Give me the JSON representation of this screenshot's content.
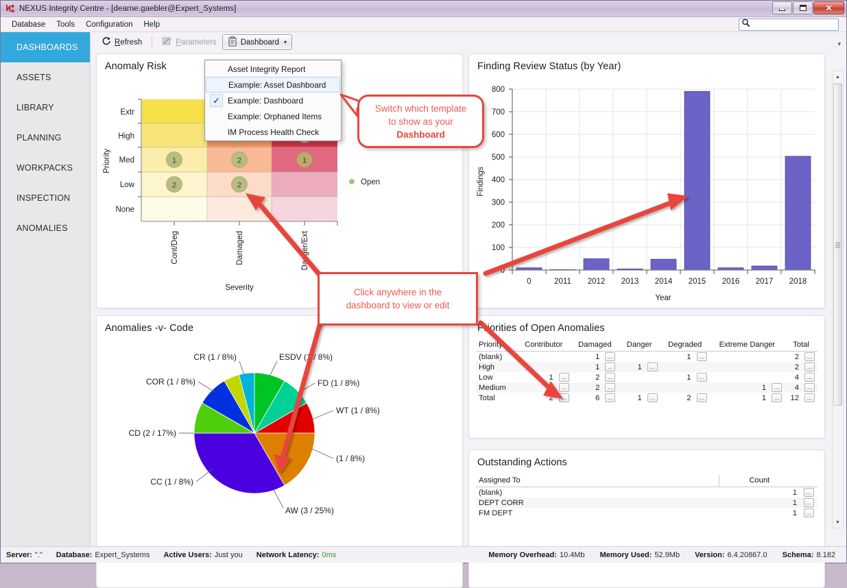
{
  "window": {
    "title": "NEXUS Integrity Centre - [dearne.gaebler@Expert_Systems]",
    "app_icon": "nexus-logo-icon",
    "minimize_label": "Minimize",
    "maximize_label": "Maximize",
    "close_label": "Close",
    "close_glyph": "✕"
  },
  "menubar": {
    "items": [
      "Database",
      "Tools",
      "Configuration",
      "Help"
    ],
    "search": {
      "value": "",
      "placeholder": "",
      "icon": "search-icon"
    }
  },
  "sidebar": {
    "items": [
      {
        "label": "DASHBOARDS",
        "active": true
      },
      {
        "label": "ASSETS",
        "active": false
      },
      {
        "label": "LIBRARY",
        "active": false
      },
      {
        "label": "PLANNING",
        "active": false
      },
      {
        "label": "WORKPACKS",
        "active": false
      },
      {
        "label": "INSPECTION",
        "active": false
      },
      {
        "label": "ANOMALIES",
        "active": false
      }
    ],
    "active_color": "#33a8dc"
  },
  "toolbar": {
    "refresh_label": "Refresh",
    "refresh_icon": "refresh-icon",
    "parameters_label": "Parameters",
    "parameters_icon": "parameters-icon",
    "parameters_disabled": true,
    "dashboard_label": "Dashboard",
    "dashboard_icon": "clipboard-icon",
    "dashboard_caret": "▾",
    "collapse_arrow": "▾"
  },
  "dropdown": {
    "items": [
      {
        "label": "Asset Integrity Report",
        "checked": false,
        "highlighted": false
      },
      {
        "label": "Example: Asset Dashboard",
        "checked": false,
        "highlighted": true
      },
      {
        "label": "Example: Dashboard",
        "checked": true,
        "highlighted": false
      },
      {
        "label": "Example: Orphaned Items",
        "checked": false,
        "highlighted": false
      },
      {
        "label": "IM Process Health Check",
        "checked": false,
        "highlighted": false
      }
    ],
    "check_glyph": "✓"
  },
  "callouts": [
    {
      "id": "template-callout",
      "lines": [
        "Switch which template",
        "to show as your"
      ],
      "bold_line": "Dashboard"
    },
    {
      "id": "click-callout",
      "lines": [
        "Click anywhere in the",
        "dashboard to view or edit"
      ],
      "bold_line": ""
    }
  ],
  "panels": {
    "anomaly_risk": {
      "title": "Anomaly Risk"
    },
    "finding_review": {
      "title": "Finding Review Status (by Year)"
    },
    "anomalies_code": {
      "title": "Anomalies -v- Code"
    },
    "priorities": {
      "title": "Priorities of Open Anomalies"
    },
    "outstanding": {
      "title": "Outstanding Actions"
    }
  },
  "chart_data": [
    {
      "id": "anomaly-risk-heatmap",
      "type": "heatmap",
      "title": "Anomaly Risk",
      "xlabel": "Severity",
      "ylabel": "Priority",
      "header_label": "Anomaly Risk",
      "xticks": [
        "Cont/Deg",
        "Damaged",
        "Danger/Ext"
      ],
      "yticks": [
        "Extr",
        "High",
        "Med",
        "Low",
        "None"
      ],
      "legend": [
        {
          "label": "Open",
          "color": "#b5b87a"
        }
      ],
      "legend_position": "right",
      "cells": [
        {
          "y": "Extr",
          "x": "Cont/Deg",
          "value": null,
          "color": "#f7e04a"
        },
        {
          "y": "Extr",
          "x": "Damaged",
          "value": null,
          "color": "#f4934f"
        },
        {
          "y": "Extr",
          "x": "Danger/Ext",
          "value": null,
          "color": "#d32f45"
        },
        {
          "y": "High",
          "x": "Cont/Deg",
          "value": null,
          "color": "#f8e479"
        },
        {
          "y": "High",
          "x": "Damaged",
          "value": 1,
          "color": "#f79b63"
        },
        {
          "y": "High",
          "x": "Danger/Ext",
          "value": 1,
          "color": "#d6334a"
        },
        {
          "y": "Med",
          "x": "Cont/Deg",
          "value": 1,
          "color": "#fbedab"
        },
        {
          "y": "Med",
          "x": "Damaged",
          "value": 2,
          "color": "#fab995"
        },
        {
          "y": "Med",
          "x": "Danger/Ext",
          "value": 1,
          "color": "#e0687f"
        },
        {
          "y": "Low",
          "x": "Cont/Deg",
          "value": 2,
          "color": "#fdf5cd"
        },
        {
          "y": "Low",
          "x": "Damaged",
          "value": 2,
          "color": "#fcdcc8"
        },
        {
          "y": "Low",
          "x": "Danger/Ext",
          "value": null,
          "color": "#ecacbd"
        },
        {
          "y": "None",
          "x": "Cont/Deg",
          "value": null,
          "color": "#fefbe7"
        },
        {
          "y": "None",
          "x": "Damaged",
          "value": null,
          "color": "#fdeade"
        },
        {
          "y": "None",
          "x": "Danger/Ext",
          "value": null,
          "color": "#f5d5de"
        }
      ]
    },
    {
      "id": "finding-review-status",
      "type": "bar",
      "title": "Finding Review Status (by Year)",
      "xlabel": "Year",
      "ylabel": "Findings",
      "categories": [
        "0",
        "2011",
        "2012",
        "2013",
        "2014",
        "2015",
        "2016",
        "2017",
        "2018"
      ],
      "values": [
        10,
        2,
        50,
        5,
        48,
        790,
        10,
        18,
        503
      ],
      "yticks": [
        0,
        100,
        200,
        300,
        400,
        500,
        600,
        700,
        800
      ],
      "ylim": [
        0,
        800
      ],
      "bar_color": "#6b63c6",
      "grid": true,
      "legend_position": "none"
    },
    {
      "id": "anomalies-v-code",
      "type": "pie",
      "title": "Anomalies -v- Code",
      "labels": [
        "ESDV (1 / 8%)",
        "FD (1 / 8%)",
        "WT (1 / 8%)",
        "(1 / 8%)",
        "AW (3 / 25%)",
        "CC (1 / 8%)",
        "CD (2 / 17%)",
        "COR (1 / 8%)",
        "CR (1 / 8%)"
      ],
      "values": [
        1,
        1,
        1,
        1,
        3,
        1,
        2,
        1,
        1
      ],
      "percents": [
        8,
        8,
        8,
        8,
        25,
        8,
        17,
        8,
        8
      ],
      "colors": [
        "#00c424",
        "#00d194",
        "#e00000",
        "#dd8000",
        "#4b00e0",
        "#4fcf0c",
        "#0030e0",
        "#c3d600",
        "#00b4d8"
      ],
      "legend_position": "labels"
    }
  ],
  "priorities_table": {
    "columns": [
      "Priority",
      "Contributor",
      "Damaged",
      "Danger",
      "Degraded",
      "Extreme Danger",
      "Total"
    ],
    "ellipsis_glyph": "…",
    "rows": [
      {
        "priority": "(blank)",
        "contributor": "",
        "damaged": "1",
        "danger": "",
        "degraded": "1",
        "extreme_danger": "",
        "total": "2"
      },
      {
        "priority": "High",
        "contributor": "",
        "damaged": "1",
        "danger": "1",
        "degraded": "",
        "extreme_danger": "",
        "total": "2"
      },
      {
        "priority": "Low",
        "contributor": "1",
        "damaged": "2",
        "danger": "",
        "degraded": "1",
        "extreme_danger": "",
        "total": "4"
      },
      {
        "priority": "Medium",
        "contributor": "1",
        "damaged": "2",
        "danger": "",
        "degraded": "",
        "extreme_danger": "1",
        "total": "4"
      },
      {
        "priority": "Total",
        "contributor": "2",
        "damaged": "6",
        "danger": "1",
        "degraded": "2",
        "extreme_danger": "1",
        "total": "12"
      }
    ]
  },
  "outstanding_table": {
    "columns": [
      "Assigned To",
      "Count"
    ],
    "ellipsis_glyph": "…",
    "rows": [
      {
        "assigned_to": "(blank)",
        "count": "1"
      },
      {
        "assigned_to": "DEPT CORR",
        "count": "1"
      },
      {
        "assigned_to": "FM DEPT",
        "count": "1"
      }
    ]
  },
  "statusbar": {
    "left": [
      {
        "key": "Server:",
        "value": "\".\""
      },
      {
        "key": "Database:",
        "value": "Expert_Systems"
      },
      {
        "key": "Active Users:",
        "value": "Just you"
      },
      {
        "key": "Network Latency:",
        "value": "0ms",
        "accent": "#2f9e2f"
      }
    ],
    "right": [
      {
        "key": "Memory Overhead:",
        "value": "10.4Mb"
      },
      {
        "key": "Memory Used:",
        "value": "52.9Mb"
      },
      {
        "key": "Version:",
        "value": "6.4.20867.0"
      },
      {
        "key": "Schema:",
        "value": "8.182"
      }
    ]
  },
  "scrollbar": {
    "up_glyph": "▲",
    "down_glyph": "▼"
  }
}
